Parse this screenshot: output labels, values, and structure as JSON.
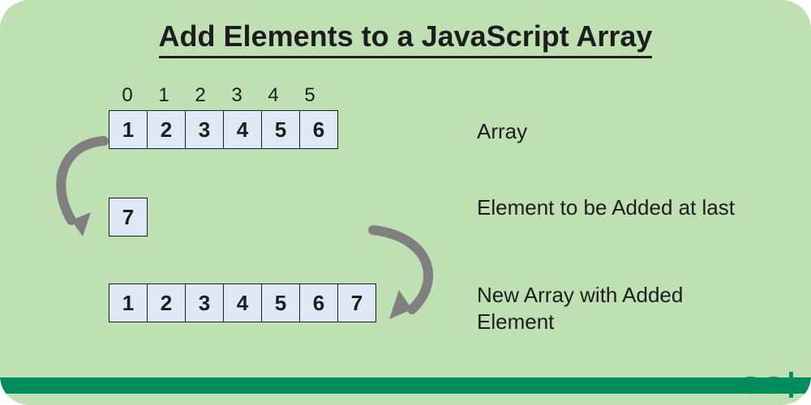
{
  "title": "Add Elements to a JavaScript Array",
  "indices": [
    "0",
    "1",
    "2",
    "3",
    "4",
    "5"
  ],
  "array_before": [
    "1",
    "2",
    "3",
    "4",
    "5",
    "6"
  ],
  "element_to_add": "7",
  "array_after": [
    "1",
    "2",
    "3",
    "4",
    "5",
    "6",
    "7"
  ],
  "labels": {
    "array": "Array",
    "element": "Element to be Added at last",
    "result": "New Array with Added Element"
  },
  "logo": "ƏG",
  "colors": {
    "bg": "#bee0b2",
    "cell": "#dfe9f5",
    "accent": "#008d5e",
    "arrow": "#808080"
  }
}
